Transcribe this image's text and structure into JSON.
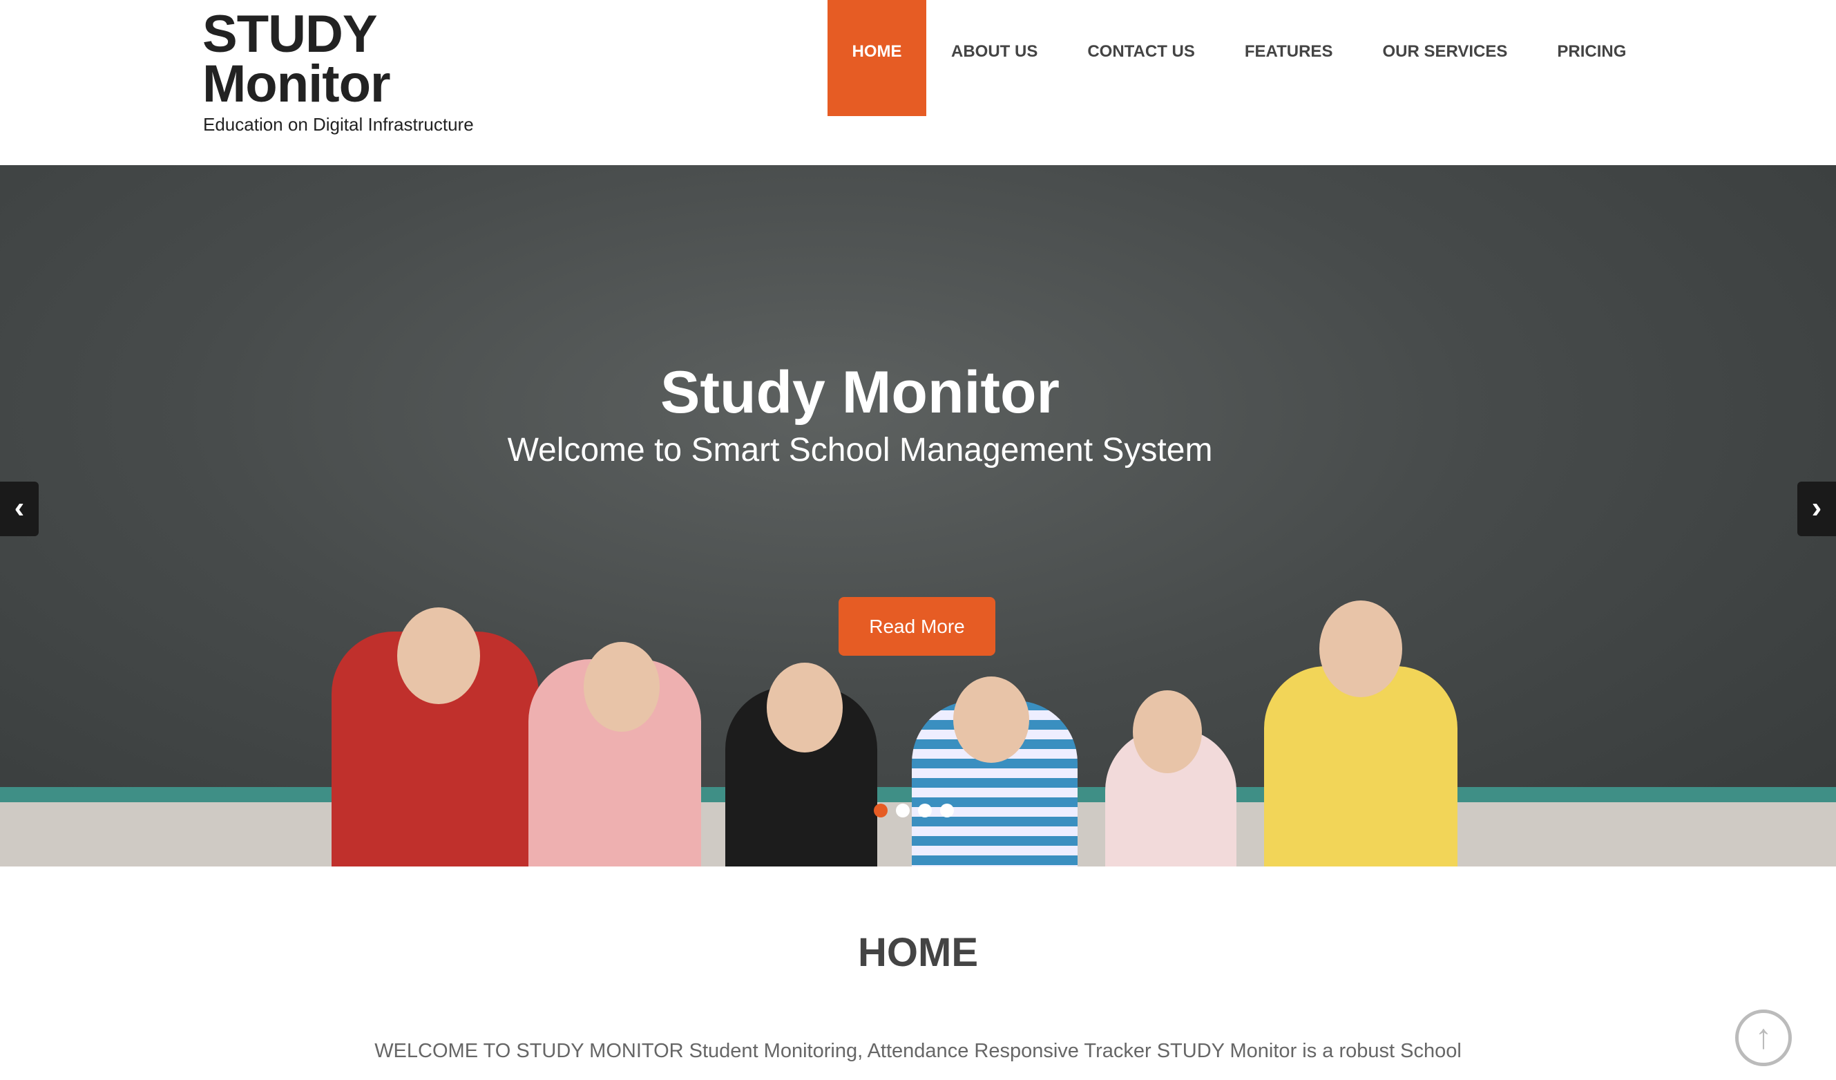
{
  "header": {
    "logo_title": "STUDY Monitor",
    "tagline": "Education on Digital Infrastructure",
    "nav": [
      {
        "label": "HOME",
        "active": true
      },
      {
        "label": "ABOUT US"
      },
      {
        "label": "CONTACT US"
      },
      {
        "label": "FEATURES"
      },
      {
        "label": "OUR SERVICES"
      },
      {
        "label": "PRICING"
      }
    ]
  },
  "hero": {
    "title": "Study Monitor",
    "subtitle": "Welcome to Smart School Management System",
    "button": "Read More",
    "prev_icon": "‹",
    "next_icon": "›",
    "slides": 4,
    "active_slide": 1
  },
  "section": {
    "title": "HOME",
    "text": "WELCOME TO STUDY MONITOR Student Monitoring, Attendance Responsive Tracker   STUDY Monitor is a robust School"
  },
  "back_to_top_icon": "↑",
  "colors": {
    "accent": "#e65c24"
  }
}
